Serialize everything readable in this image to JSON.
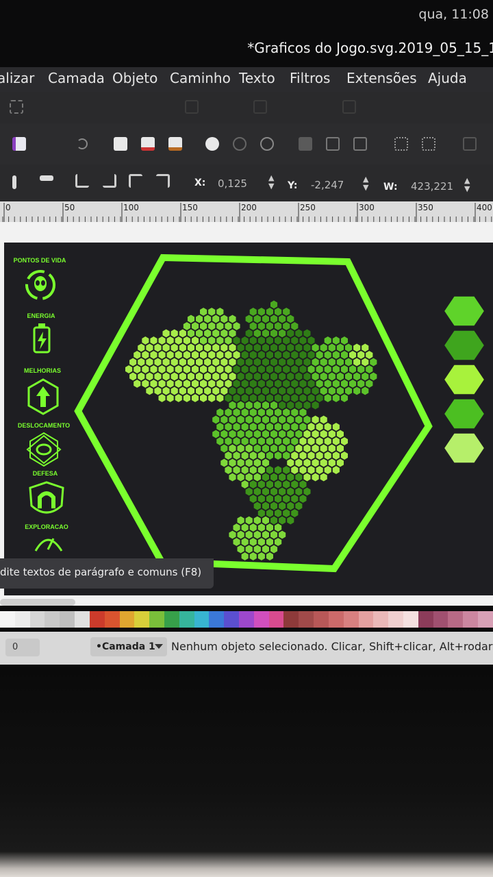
{
  "system": {
    "clock": "qua, 11:08"
  },
  "window": {
    "title": "*Graficos do Jogo.svg.2019_05_15_1"
  },
  "menu": [
    "alizar",
    "Camada",
    "Objeto",
    "Caminho",
    "Texto",
    "Filtros",
    "Extensões",
    "Ajuda"
  ],
  "coords": {
    "x_label": "X:",
    "x_value": "0,125",
    "y_label": "Y:",
    "y_value": "-2,247",
    "w_label": "W:",
    "w_value": "423,221"
  },
  "ruler": {
    "labels": [
      "0",
      "50",
      "100",
      "150",
      "200",
      "250",
      "300",
      "350",
      "400"
    ]
  },
  "game": {
    "hud_labels": [
      "PONTOS DE VIDA",
      "ENERGIA",
      "MELHORIAS",
      "DESLOCAMENTO",
      "DEFESA",
      "EXPLORACAO"
    ],
    "hud_icons": [
      "alien-cycle-icon",
      "battery-icon",
      "upgrade-arrow-icon",
      "compass-star-icon",
      "shield-magnet-icon",
      "explore-icon"
    ],
    "swatch_colors": [
      "#5fd32a",
      "#3fa51e",
      "#a8f23c",
      "#4cbf22",
      "#b6ef6a"
    ],
    "accent": "#7aff2e",
    "region_colors": [
      "#a8ec4a",
      "#4aa820",
      "#2f7d16",
      "#7fd83a",
      "#5cc22a",
      "#3d941a"
    ]
  },
  "hint": {
    "text": "dite textos de parágrafo e comuns (F8)"
  },
  "palette_colors": [
    "#f5f5f5",
    "#ececec",
    "#d6d6d6",
    "#c9c9c9",
    "#bfbfbf",
    "#e0e0e0",
    "#cc3b2b",
    "#d9542f",
    "#e0a630",
    "#d8cf3a",
    "#7abf3a",
    "#37a04a",
    "#36b59c",
    "#38b5d1",
    "#3b78d8",
    "#5b4fd0",
    "#9d48cc",
    "#d14fbe",
    "#d84b8f",
    "#8e3a3a",
    "#a04a4a",
    "#b85858",
    "#cc6a6a",
    "#d88080",
    "#e4a0a0",
    "#ebb8b8",
    "#f0cfcf",
    "#f5e0e0",
    "#8c3c5a",
    "#a05070",
    "#b86a86",
    "#cc86a0",
    "#d8a0b6"
  ],
  "status": {
    "zoom": "0",
    "layer": "•Camada 1",
    "message": "Nenhum objeto selecionado. Clicar, Shift+clicar, Alt+rodar (b"
  }
}
